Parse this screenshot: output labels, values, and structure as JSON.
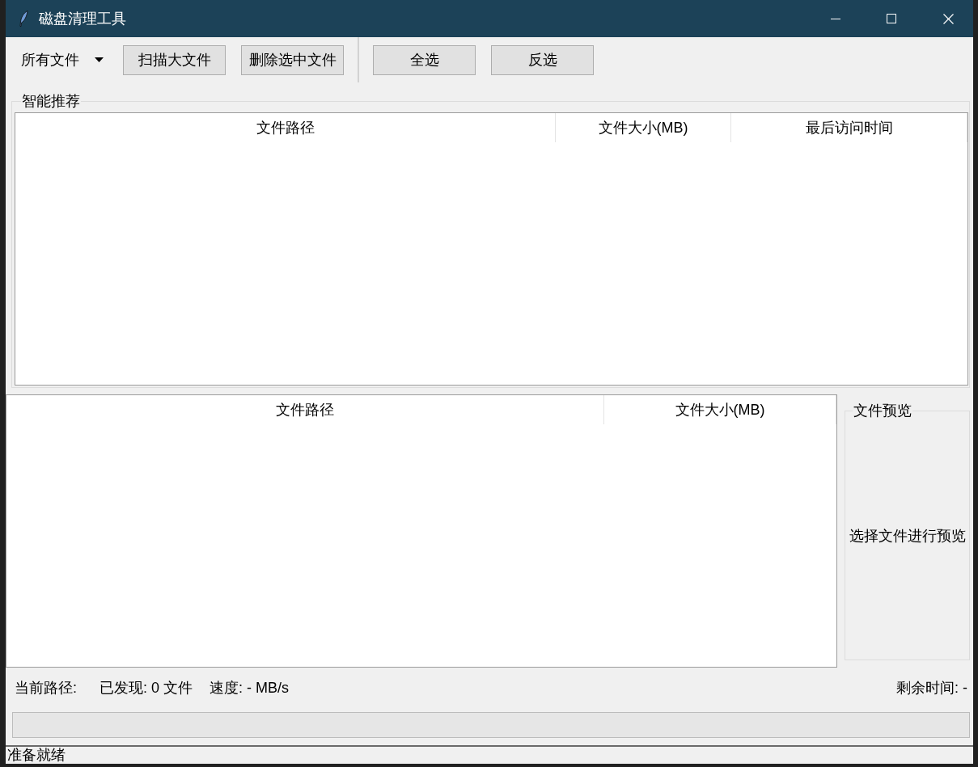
{
  "window": {
    "title": "磁盘清理工具"
  },
  "toolbar": {
    "filter": {
      "value": "所有文件"
    },
    "actions": [
      {
        "label": "扫描大文件"
      },
      {
        "label": "删除选中文件"
      }
    ],
    "selection": [
      {
        "label": "全选"
      },
      {
        "label": "反选"
      }
    ]
  },
  "recommendations": {
    "title": "智能推荐",
    "columns": [
      "文件路径",
      "文件大小(MB)",
      "最后访问时间"
    ]
  },
  "files": {
    "columns": [
      "文件路径",
      "文件大小(MB)"
    ]
  },
  "preview": {
    "title": "文件预览",
    "hint": "选择文件进行预览"
  },
  "stats": {
    "current_path": "当前路径:",
    "found": "已发现: 0 文件",
    "speed": "速度: - MB/s",
    "remaining": "剩余时间: -"
  },
  "progress": {
    "level": 0
  },
  "status_bar": {
    "text": "准备就绪"
  }
}
